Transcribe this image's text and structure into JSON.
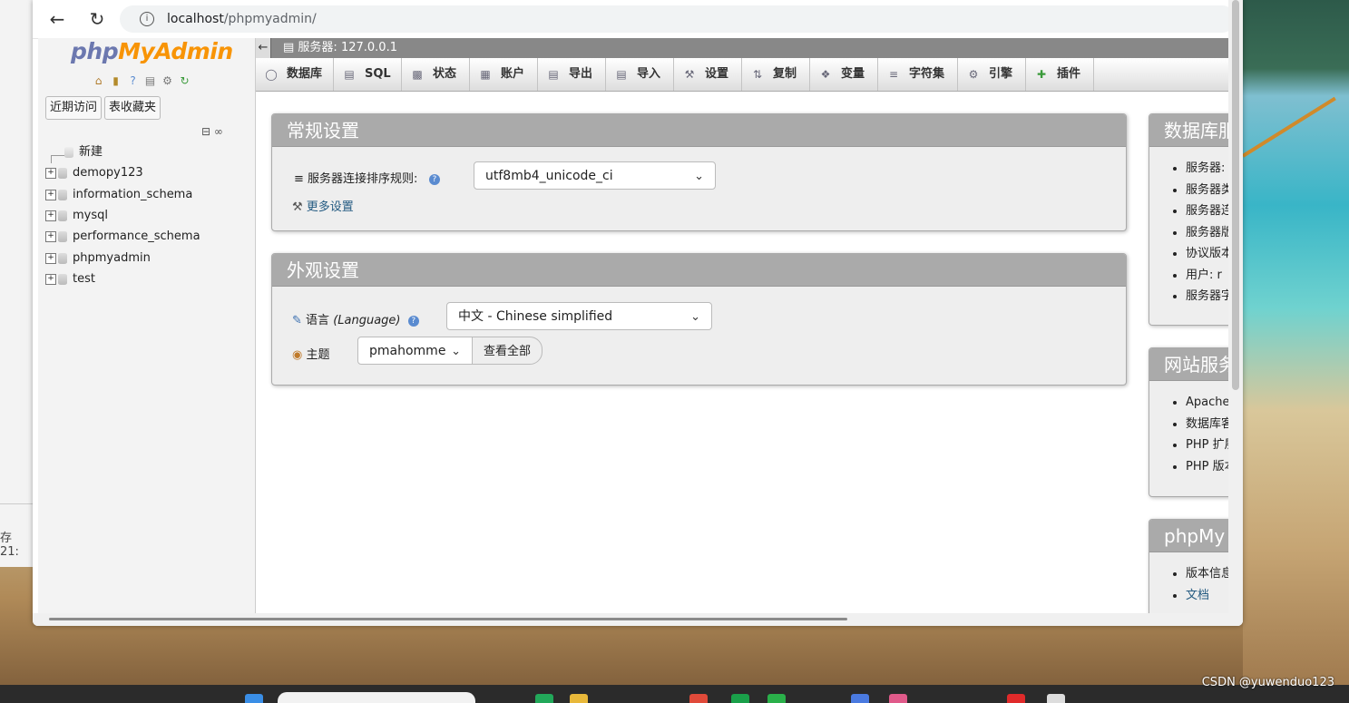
{
  "browser": {
    "url_host": "localhost",
    "url_path": "/phpmyadmin/",
    "back_icon": "arrow-left-icon",
    "reload_icon": "reload-icon"
  },
  "background": {
    "left_text": "存 21:",
    "watermark": "CSDN @yuwenduo123"
  },
  "nav": {
    "logo_php": "php",
    "logo_myadmin": "MyAdmin",
    "tab_recent": "近期访问",
    "tab_favorites": "表收藏夹",
    "new_label": "新建",
    "databases": [
      "demopy123",
      "information_schema",
      "mysql",
      "performance_schema",
      "phpmyadmin",
      "test"
    ]
  },
  "serverbar": {
    "label": "服务器:",
    "value": "127.0.0.1"
  },
  "menu": [
    {
      "label": "数据库",
      "icon": "database-icon"
    },
    {
      "label": "SQL",
      "icon": "sql-icon"
    },
    {
      "label": "状态",
      "icon": "status-icon"
    },
    {
      "label": "账户",
      "icon": "accounts-icon"
    },
    {
      "label": "导出",
      "icon": "export-icon"
    },
    {
      "label": "导入",
      "icon": "import-icon"
    },
    {
      "label": "设置",
      "icon": "wrench-icon"
    },
    {
      "label": "复制",
      "icon": "replication-icon"
    },
    {
      "label": "变量",
      "icon": "variables-icon"
    },
    {
      "label": "字符集",
      "icon": "charset-icon"
    },
    {
      "label": "引擎",
      "icon": "engine-icon"
    },
    {
      "label": "插件",
      "icon": "plugin-icon"
    }
  ],
  "general": {
    "title": "常规设置",
    "collation_label": "服务器连接排序规则:",
    "collation_value": "utf8mb4_unicode_ci",
    "more_settings": "更多设置"
  },
  "appearance": {
    "title": "外观设置",
    "language_label": "语言",
    "language_en": "(Language)",
    "language_value": "中文 - Chinese simplified",
    "theme_label": "主题",
    "theme_value": "pmahomme",
    "view_all": "查看全部"
  },
  "db_server": {
    "title": "数据库服",
    "items": [
      "服务器: ",
      "服务器类",
      "服务器连",
      "服务器版",
      "协议版本",
      "用户: r",
      "服务器字"
    ]
  },
  "web_server": {
    "title": "网站服务",
    "items": [
      "Apache",
      "数据库客",
      "PHP 扩展",
      "PHP 版本"
    ]
  },
  "pma_info": {
    "title": "phpMy",
    "items": [
      "版本信息",
      "文档"
    ]
  }
}
